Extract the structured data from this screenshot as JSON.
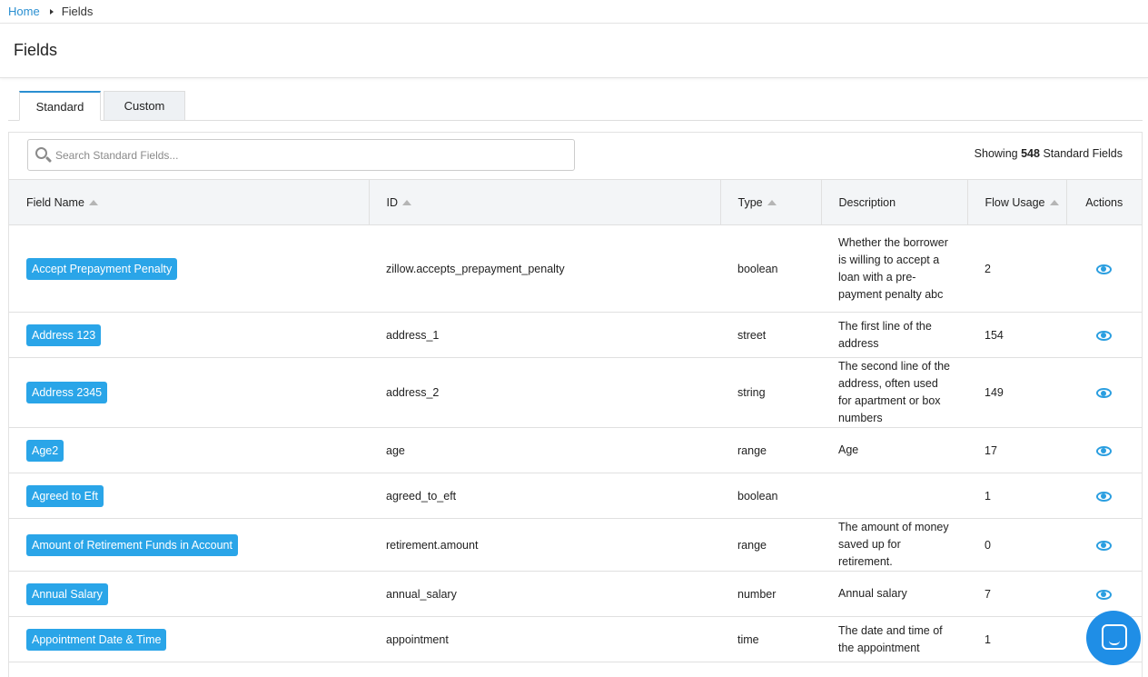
{
  "breadcrumb": {
    "home": "Home",
    "current": "Fields"
  },
  "page": {
    "title": "Fields"
  },
  "tabs": [
    {
      "label": "Standard"
    },
    {
      "label": "Custom"
    }
  ],
  "search": {
    "placeholder": "Search Standard Fields..."
  },
  "showing": {
    "prefix": "Showing",
    "count": "548",
    "suffix": "Standard Fields"
  },
  "columns": {
    "field_name": "Field Name",
    "id": "ID",
    "type": "Type",
    "description": "Description",
    "flow_usage": "Flow Usage",
    "actions": "Actions"
  },
  "rows": [
    {
      "name": "Accept Prepayment Penalty",
      "id": "zillow.accepts_prepayment_penalty",
      "type": "boolean",
      "description": "Whether the borrower is willing to accept a loan with a pre-payment penalty abc",
      "usage": "2"
    },
    {
      "name": "Address 123",
      "id": "address_1",
      "type": "street",
      "description": "The first line of the address",
      "usage": "154"
    },
    {
      "name": "Address 2345",
      "id": "address_2",
      "type": "string",
      "description": "The second line of the address, often used for apartment or box numbers",
      "usage": "149"
    },
    {
      "name": "Age2",
      "id": "age",
      "type": "range",
      "description": "Age",
      "usage": "17"
    },
    {
      "name": "Agreed to Eft",
      "id": "agreed_to_eft",
      "type": "boolean",
      "description": "",
      "usage": "1"
    },
    {
      "name": "Amount of Retirement Funds in Account",
      "id": "retirement.amount",
      "type": "range",
      "description": "The amount of money saved up for retirement.",
      "usage": "0"
    },
    {
      "name": "Annual Salary",
      "id": "annual_salary",
      "type": "number",
      "description": "Annual salary",
      "usage": "7"
    },
    {
      "name": "Appointment Date & Time",
      "id": "appointment",
      "type": "time",
      "description": "The date and time of the appointment",
      "usage": "1"
    }
  ],
  "colors": {
    "accent": "#2aa5e8",
    "link": "#2a8fd1",
    "chat": "#1f8ee6"
  },
  "icons": {
    "search": "search-icon",
    "view": "eye-icon",
    "chat": "chat-icon"
  }
}
